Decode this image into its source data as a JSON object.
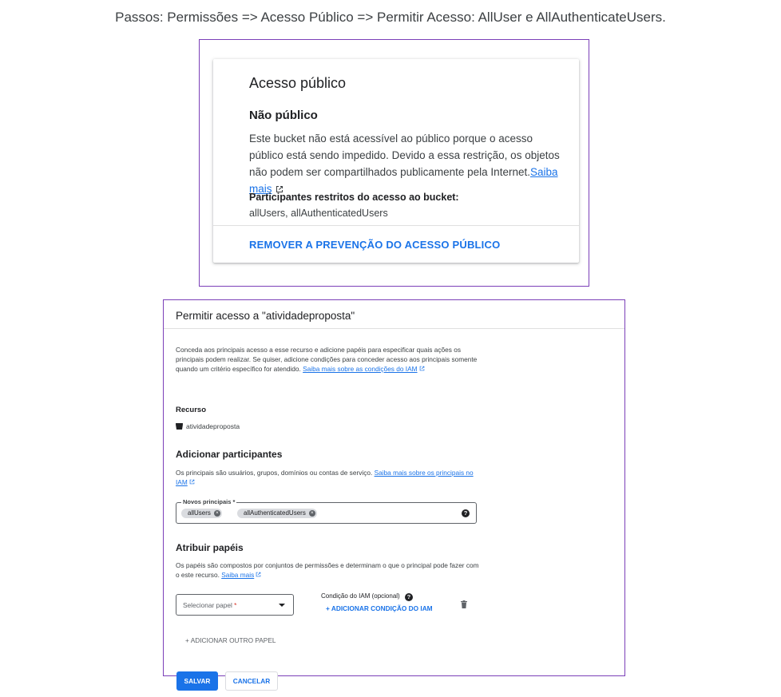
{
  "caption": "Passos: Permissões => Acesso Público => Permitir Acesso: AllUser e AllAuthenticateUsers.",
  "public_access_card": {
    "title": "Acesso público",
    "status": "Não público",
    "description": "Este bucket não está acessível ao público porque o acesso público está sendo impedido. Devido a essa restrição, os objetos não podem ser compartilhados publicamente pela Internet.",
    "learn_more": "Saiba mais",
    "restricted_title": "Participantes restritos do acesso ao bucket:",
    "restricted_value": "allUsers, allAuthenticatedUsers",
    "action": "REMOVER A PREVENÇÃO DO ACESSO PÚBLICO"
  },
  "grant_dialog": {
    "title": "Permitir acesso a \"atividadeproposta\"",
    "intro": "Conceda aos principais acesso a esse recurso e adicione papéis para especificar quais ações os principais podem realizar. Se quiser, adicione condições para conceder acesso aos principais somente quando um critério específico for atendido.",
    "intro_link": "Saiba mais sobre as condições do IAM",
    "resource_label": "Recurso",
    "resource_name": "atividadeproposta",
    "add_principals_title": "Adicionar participantes",
    "add_principals_desc": "Os principais são usuários, grupos, domínios ou contas de serviço.",
    "add_principals_link": "Saiba mais sobre os principais no IAM",
    "new_principals_label": "Novos principais *",
    "principals": [
      "allUsers",
      "allAuthenticatedUsers"
    ],
    "assign_roles_title": "Atribuir papéis",
    "assign_roles_desc": "Os papéis são compostos por conjuntos de permissões e determinam o que o principal pode fazer com o este recurso.",
    "assign_roles_link": "Saiba mais",
    "role_placeholder": "Selecionar papel",
    "role_required": "*",
    "iam_condition_label": "Condição do IAM (opcional)",
    "add_iam_condition": "+ ADICIONAR CONDIÇÃO DO IAM",
    "add_other_role": "+ ADICIONAR OUTRO PAPEL",
    "save": "SALVAR",
    "cancel": "CANCELAR"
  },
  "colors": {
    "accent": "#1a73e8",
    "frame": "#7b3fb8",
    "chip": "#dadce0"
  },
  "icons": [
    "external-link-icon",
    "bucket-icon",
    "chip-remove-icon",
    "help-icon",
    "dropdown-caret-icon",
    "trash-icon"
  ]
}
